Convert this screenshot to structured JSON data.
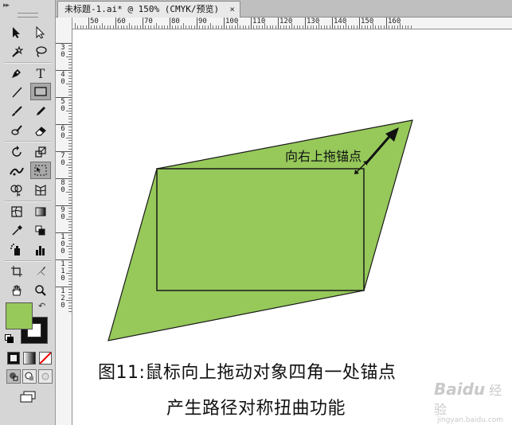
{
  "document": {
    "tab_title": "未标题-1.ai* @ 150% (CMYK/预览)",
    "close_glyph": "×"
  },
  "ruler": {
    "top_labels": [
      "50",
      "60",
      "70",
      "80",
      "90",
      "100",
      "110",
      "120",
      "130",
      "140",
      "150",
      "160"
    ],
    "left_labels": [
      "3 0",
      "4 0",
      "5 0",
      "6 0",
      "7 0",
      "8 0",
      "9 0",
      "1 0 0",
      "1 1 0",
      "1 2 0"
    ]
  },
  "toolbar": {
    "tools": [
      {
        "name": "selection-tool-icon"
      },
      {
        "name": "direct-selection-tool-icon"
      },
      {
        "name": "magic-wand-tool-icon"
      },
      {
        "name": "lasso-tool-icon"
      },
      {
        "name": "pen-tool-icon"
      },
      {
        "name": "type-tool-icon",
        "glyph": "T"
      },
      {
        "name": "line-segment-tool-icon"
      },
      {
        "name": "rectangle-tool-icon"
      },
      {
        "name": "paintbrush-tool-icon"
      },
      {
        "name": "pencil-tool-icon"
      },
      {
        "name": "blob-brush-tool-icon"
      },
      {
        "name": "eraser-tool-icon"
      },
      {
        "name": "rotate-tool-icon"
      },
      {
        "name": "scale-tool-icon"
      },
      {
        "name": "width-tool-icon"
      },
      {
        "name": "free-transform-tool-icon"
      },
      {
        "name": "shape-builder-tool-icon"
      },
      {
        "name": "perspective-grid-tool-icon"
      },
      {
        "name": "mesh-tool-icon"
      },
      {
        "name": "gradient-tool-icon"
      },
      {
        "name": "eyedropper-tool-icon"
      },
      {
        "name": "blend-tool-icon"
      },
      {
        "name": "symbol-sprayer-tool-icon"
      },
      {
        "name": "column-graph-tool-icon"
      },
      {
        "name": "artboard-tool-icon"
      },
      {
        "name": "slice-tool-icon"
      },
      {
        "name": "hand-tool-icon"
      },
      {
        "name": "zoom-tool-icon"
      }
    ],
    "active_tool": "free-transform-tool-icon",
    "fill_color": "#97c95a",
    "stroke_color": "#111111"
  },
  "artwork": {
    "fill_color": "#96c95a",
    "stroke_color": "#1a1a1a",
    "annotation": "向右上拖锚点"
  },
  "caption": {
    "line1": "图11:鼠标向上拖动对象四角一处锚点",
    "line2": "产生路径对称扭曲功能"
  },
  "watermark": {
    "brand": "Baidu",
    "sub": "经验",
    "url": "jingyan.baidu.com"
  }
}
